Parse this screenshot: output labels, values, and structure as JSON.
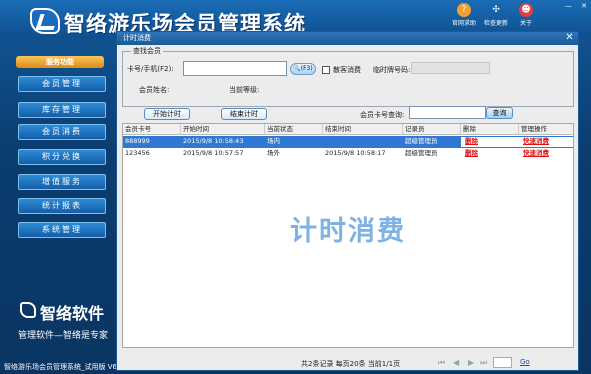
{
  "app": {
    "title": "智络游乐场会员管理系统",
    "status_left": "智络游乐场会员管理系统_试用版  V6.",
    "tools": [
      {
        "label": "官网求助",
        "icon": "help-icon"
      },
      {
        "label": "检查更新",
        "icon": "update-icon"
      },
      {
        "label": "关于",
        "icon": "about-icon"
      }
    ],
    "window_controls": {
      "minimize": "—",
      "close": "✕"
    }
  },
  "sidebar": {
    "header": "服务功能",
    "items": [
      {
        "label": "会员管理"
      },
      {
        "label": "库存管理"
      },
      {
        "label": "会员消费"
      },
      {
        "label": "积分兑换"
      },
      {
        "label": "增值服务"
      },
      {
        "label": "统计报表"
      },
      {
        "label": "系统管理"
      }
    ],
    "brand": "智络软件",
    "slogan": "管理软件—智络是专家"
  },
  "child_window": {
    "title": "计时消费",
    "close": "✕"
  },
  "query": {
    "legend": "查找会员",
    "card_label": "卡号/手机(F2):",
    "card_value": "",
    "f3_label": "(F3)",
    "checkbox_label": "散客消费",
    "temp_card_label": "临时牌号码:",
    "member_name_label": "会员姓名:",
    "level_label": "当前等级:",
    "start_btn": "开始计时",
    "end_btn": "结束计时",
    "lookup_label": "会员卡号查询:",
    "lookup_value": "",
    "lookup_btn": "查询"
  },
  "table": {
    "columns": [
      "会员卡号",
      "开始时间",
      "当前状态",
      "结束时间",
      "记录员",
      "删除",
      "管理操作"
    ],
    "rows": [
      {
        "card": "888999",
        "start": "2015/9/8  10:58:43",
        "status": "场内",
        "end": "",
        "clerk": "超级管理员",
        "del": "删除",
        "op": "快速消费",
        "selected": true
      },
      {
        "card": "123456",
        "start": "2015/9/8  10:57:57",
        "status": "场外",
        "end": "2015/9/8  10:58:17",
        "clerk": "超级管理员",
        "del": "删除",
        "op": "快速消费",
        "selected": false
      }
    ]
  },
  "watermark": "计时消费",
  "pager": {
    "text": "共2条记录  每页20条  当前1/1页",
    "first": "⏮",
    "prev": "◀",
    "next": "▶",
    "last": "⏭",
    "page_value": "",
    "go": "Go"
  },
  "colors": {
    "selected_row": "#2f78d4",
    "danger": "#e01010",
    "accent": "#f0a030"
  }
}
